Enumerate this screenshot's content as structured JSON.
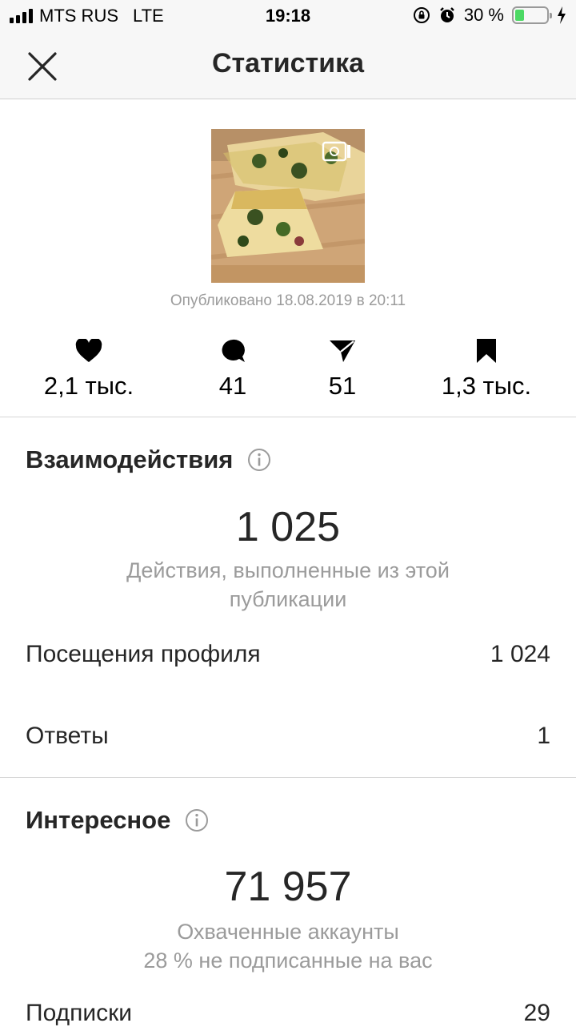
{
  "status_bar": {
    "carrier": "MTS RUS",
    "network": "LTE",
    "time": "19:18",
    "battery_text": "30 %",
    "battery_level": 0.3,
    "battery_color": "#4cd964"
  },
  "nav": {
    "title": "Статистика",
    "close_icon": "close-icon"
  },
  "post": {
    "published": "Опубликовано 18.08.2019 в 20:11",
    "media_badge_icon": "carousel-icon"
  },
  "metrics": {
    "likes": "2,1 тыс.",
    "comments": "41",
    "shares": "51",
    "saves": "1,3 тыс."
  },
  "interactions": {
    "title": "Взаимодействия",
    "total": "1 025",
    "caption": "Действия, выполненные из этой публикации",
    "rows": [
      {
        "label": "Посещения профиля",
        "value": "1 024"
      },
      {
        "label": "Ответы",
        "value": "1"
      }
    ]
  },
  "discovery": {
    "title": "Интересное",
    "total": "71 957",
    "caption_line1": "Охваченные аккаунты",
    "caption_line2": "28 % не подписанные на вас",
    "rows": [
      {
        "label": "Подписки",
        "value": "29"
      }
    ]
  }
}
